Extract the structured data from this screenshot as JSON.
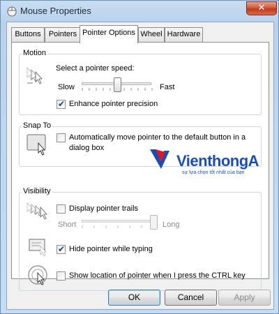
{
  "window": {
    "title": "Mouse Properties",
    "close_glyph": "✕",
    "icon": "mouse-icon"
  },
  "tabs": [
    {
      "label": "Buttons",
      "active": false
    },
    {
      "label": "Pointers",
      "active": false
    },
    {
      "label": "Pointer Options",
      "active": true
    },
    {
      "label": "Wheel",
      "active": false
    },
    {
      "label": "Hardware",
      "active": false
    }
  ],
  "motion": {
    "group_title": "Motion",
    "speed_label": "Select a pointer speed:",
    "slow_label": "Slow",
    "fast_label": "Fast",
    "speed_value": 0.5,
    "precision_label": "Enhance pointer precision",
    "precision_checked": true,
    "icon": "pointer-speed-icon"
  },
  "snap_to": {
    "group_title": "Snap To",
    "label_line1": "Automatically move pointer to the default button in a",
    "label_line2": "dialog box",
    "checked": false,
    "icon": "snap-to-icon"
  },
  "visibility": {
    "group_title": "Visibility",
    "trails_label": "Display pointer trails",
    "trails_checked": false,
    "short_label": "Short",
    "long_label": "Long",
    "trails_value": 1.0,
    "hide_label": "Hide pointer while typing",
    "hide_checked": true,
    "show_location_label": "Show location of pointer when I press the CTRL key",
    "show_location_checked": false,
    "icons": [
      "pointer-trails-icon",
      "hide-pointer-icon",
      "pointer-location-icon"
    ]
  },
  "buttons": {
    "ok": "OK",
    "cancel": "Cancel",
    "apply": "Apply"
  },
  "watermark": {
    "brand": "VienthongA",
    "tagline": "sự lựa chọn tốt nhất của bạn",
    "colors": {
      "blue": "#1a4fb0",
      "red": "#d7192f"
    }
  },
  "colors": {
    "title_bar": "#b9d2ec",
    "close_button": "#c0391a",
    "panel": "#ffffff",
    "dialog": "#f0f0f0"
  }
}
